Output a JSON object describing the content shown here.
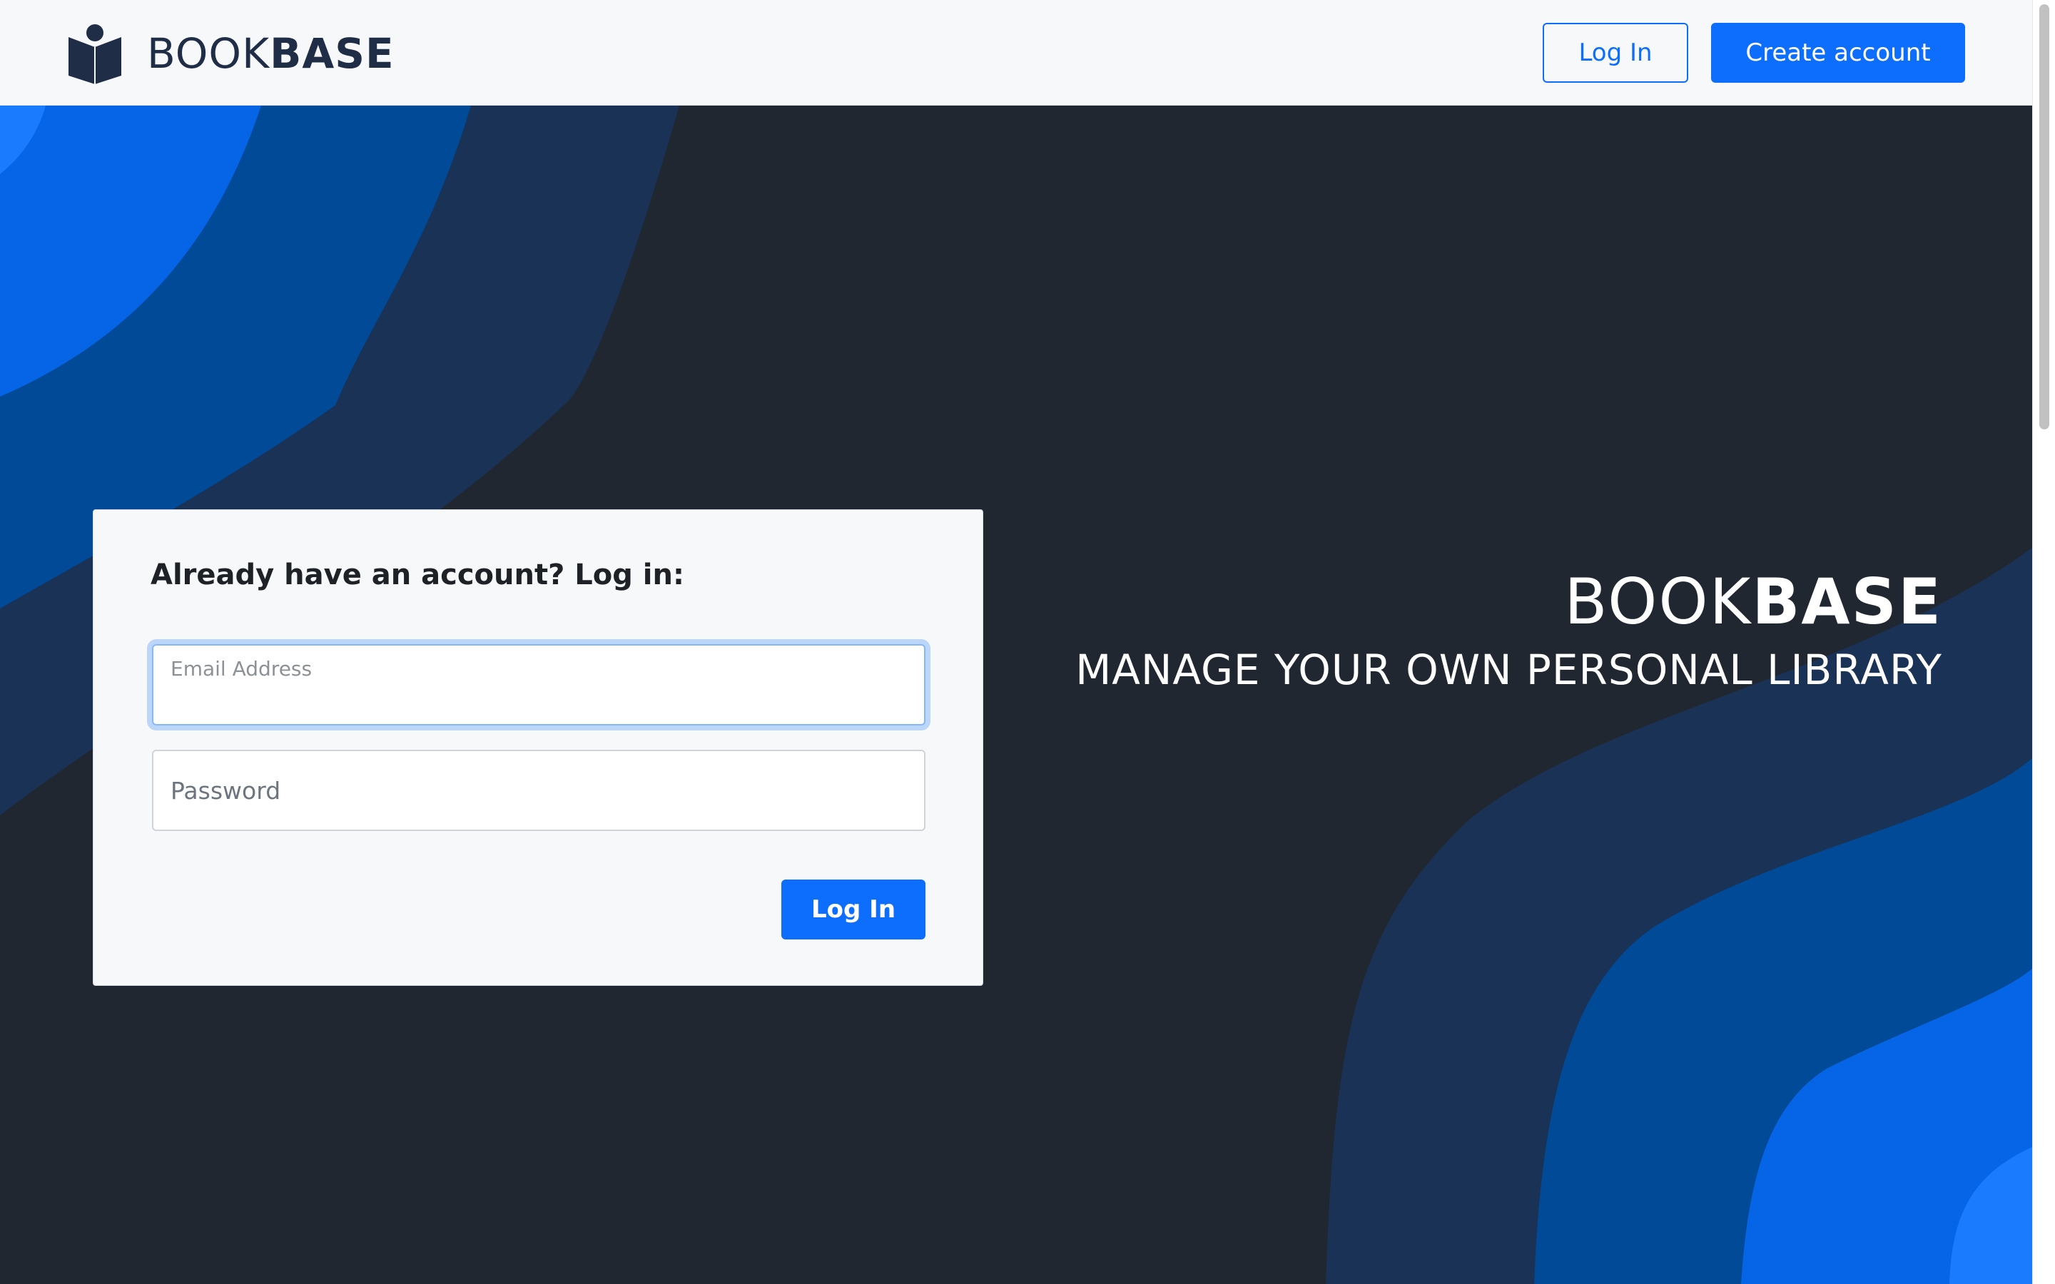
{
  "header": {
    "brand_light": "BOOK",
    "brand_bold": "BASE",
    "login_label": "Log In",
    "create_account_label": "Create account"
  },
  "login_form": {
    "title": "Already have an account? Log in:",
    "email_label": "Email Address",
    "email_value": "",
    "password_placeholder": "Password",
    "submit_label": "Log In"
  },
  "hero": {
    "brand_light": "BOOK",
    "brand_bold": "BASE",
    "tagline": "MANAGE YOUR OWN PERSONAL LIBRARY"
  },
  "colors": {
    "primary": "#0d6efd",
    "dark_background": "#212731",
    "header_background": "#f7f8fa",
    "brand_navy": "#1f2d47",
    "wave_dark": "#193255",
    "wave_mid": "#004a98",
    "wave_bright": "#0565e6"
  },
  "icons": {
    "logo": "book-reader-icon"
  }
}
